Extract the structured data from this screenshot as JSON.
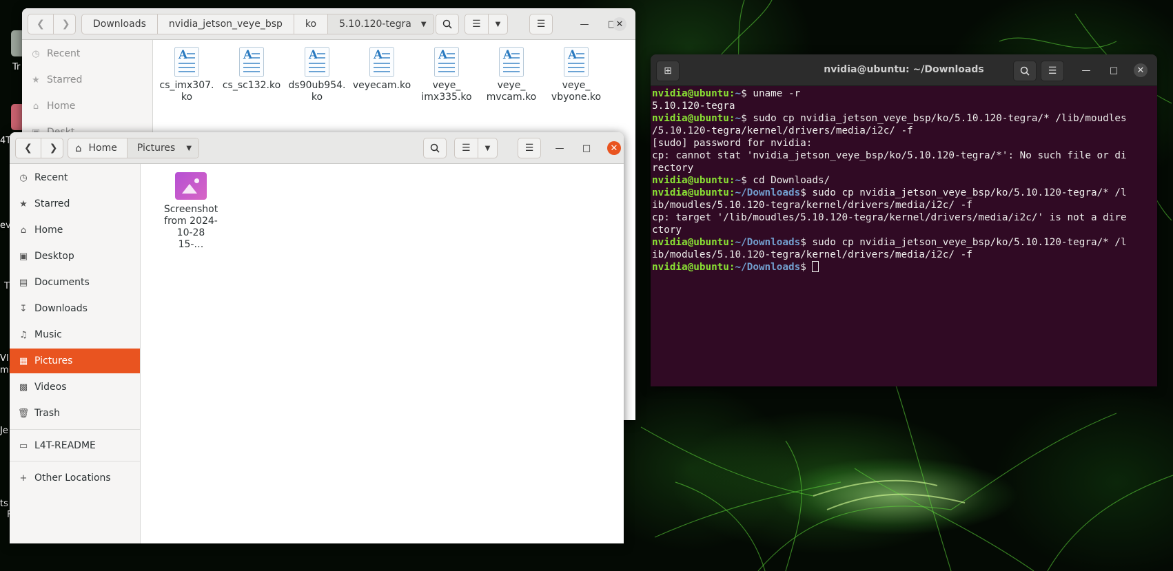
{
  "desktop": {
    "fragments": [
      "Tr",
      "4T",
      "eve",
      "T",
      "VI",
      "mi",
      "Je",
      "ts",
      "F"
    ]
  },
  "file_manager_back": {
    "path": [
      "Downloads",
      "nvidia_jetson_veye_bsp",
      "ko",
      "5.10.120-tegra"
    ],
    "sidebar": [
      "Recent",
      "Starred",
      "Home",
      "Deskt"
    ],
    "files": [
      {
        "line1": "cs_imx307.",
        "line2": "ko"
      },
      {
        "line1": "cs_sc132.ko",
        "line2": ""
      },
      {
        "line1": "ds90ub954.",
        "line2": "ko"
      },
      {
        "line1": "veyecam.ko",
        "line2": ""
      },
      {
        "line1": "veye_",
        "line2": "imx335.ko"
      },
      {
        "line1": "veye_",
        "line2": "mvcam.ko"
      },
      {
        "line1": "veye_",
        "line2": "vbyone.ko"
      }
    ]
  },
  "file_manager_front": {
    "path": [
      "Home",
      "Pictures"
    ],
    "sidebar": [
      {
        "label": "Recent",
        "icon": "clock-icon"
      },
      {
        "label": "Starred",
        "icon": "star-icon"
      },
      {
        "label": "Home",
        "icon": "home-icon"
      },
      {
        "label": "Desktop",
        "icon": "desktop-icon"
      },
      {
        "label": "Documents",
        "icon": "documents-icon"
      },
      {
        "label": "Downloads",
        "icon": "download-icon"
      },
      {
        "label": "Music",
        "icon": "music-icon"
      },
      {
        "label": "Pictures",
        "icon": "pictures-icon"
      },
      {
        "label": "Videos",
        "icon": "videos-icon"
      },
      {
        "label": "Trash",
        "icon": "trash-icon"
      },
      {
        "label": "L4T-README",
        "icon": "drive-icon"
      },
      {
        "label": "Other Locations",
        "icon": "plus-icon"
      }
    ],
    "active_item": "Pictures",
    "files": [
      {
        "line1": "Screenshot",
        "line2": "from 2024-",
        "line3": "10-28 15-…"
      }
    ]
  },
  "terminal": {
    "title": "nvidia@ubuntu: ~/Downloads",
    "lines": [
      {
        "user": "nvidia@ubuntu",
        "path": "~",
        "cmd": " uname -r"
      },
      {
        "text": "5.10.120-tegra"
      },
      {
        "user": "nvidia@ubuntu",
        "path": "~",
        "cmd": " sudo cp nvidia_jetson_veye_bsp/ko/5.10.120-tegra/* /lib/moudles"
      },
      {
        "text": "/5.10.120-tegra/kernel/drivers/media/i2c/ -f"
      },
      {
        "text": "[sudo] password for nvidia:"
      },
      {
        "text": "cp: cannot stat 'nvidia_jetson_veye_bsp/ko/5.10.120-tegra/*': No such file or di"
      },
      {
        "text": "rectory"
      },
      {
        "user": "nvidia@ubuntu",
        "path": "~",
        "cmd": " cd Downloads/"
      },
      {
        "user": "nvidia@ubuntu",
        "path": "~/Downloads",
        "cmd": " sudo cp nvidia_jetson_veye_bsp/ko/5.10.120-tegra/* /l"
      },
      {
        "text": "ib/moudles/5.10.120-tegra/kernel/drivers/media/i2c/ -f"
      },
      {
        "text": "cp: target '/lib/moudles/5.10.120-tegra/kernel/drivers/media/i2c/' is not a dire"
      },
      {
        "text": "ctory"
      },
      {
        "user": "nvidia@ubuntu",
        "path": "~/Downloads",
        "cmd": " sudo cp nvidia_jetson_veye_bsp/ko/5.10.120-tegra/* /l"
      },
      {
        "text": "ib/modules/5.10.120-tegra/kernel/drivers/media/i2c/ -f"
      },
      {
        "user": "nvidia@ubuntu",
        "path": "~/Downloads",
        "cmd": " ",
        "cursor": true
      }
    ]
  },
  "colors": {
    "accent": "#e95420",
    "terminal_bg": "#300a24",
    "prompt_user": "#8ae234",
    "prompt_path": "#729fcf"
  }
}
